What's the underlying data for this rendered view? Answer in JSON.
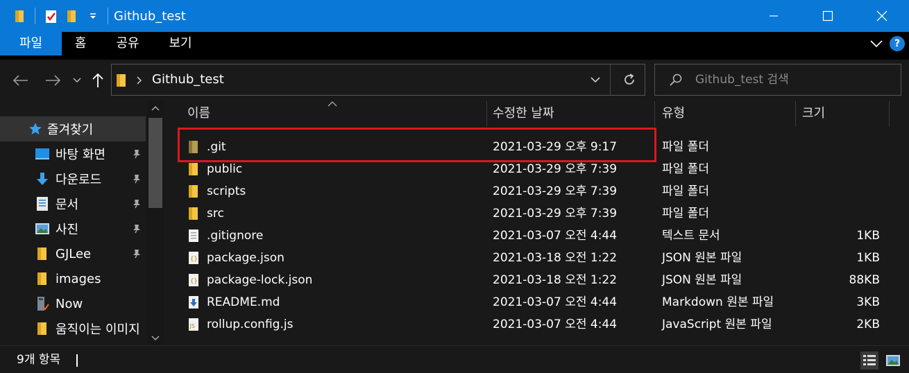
{
  "window": {
    "title": "Github_test",
    "accent": "#0a78d7",
    "highlight_color": "#e2151c"
  },
  "ribbon": {
    "tabs": [
      {
        "label": "파일",
        "active": true
      },
      {
        "label": "홈",
        "active": false
      },
      {
        "label": "공유",
        "active": false
      },
      {
        "label": "보기",
        "active": false
      }
    ],
    "help_label": "?"
  },
  "address": {
    "path": "Github_test",
    "search_placeholder": "Github_test 검색"
  },
  "sidebar": {
    "items": [
      {
        "label": "즐겨찾기",
        "icon": "star-icon",
        "pinned": false,
        "selected": true
      },
      {
        "label": "바탕 화면",
        "icon": "desktop-icon",
        "pinned": true
      },
      {
        "label": "다운로드",
        "icon": "download-icon",
        "pinned": true
      },
      {
        "label": "문서",
        "icon": "document-icon",
        "pinned": true
      },
      {
        "label": "사진",
        "icon": "pictures-icon",
        "pinned": true
      },
      {
        "label": "GJLee",
        "icon": "folder-icon",
        "pinned": true
      },
      {
        "label": "images",
        "icon": "folder-icon",
        "pinned": false
      },
      {
        "label": "Now",
        "icon": "drive-icon",
        "pinned": false
      },
      {
        "label": "움직이는 이미지",
        "icon": "folder-icon",
        "pinned": false
      }
    ]
  },
  "columns": {
    "name": "이름",
    "modified": "수정한 날짜",
    "type": "유형",
    "size": "크기"
  },
  "files": [
    {
      "name": ".git",
      "modified": "2021-03-29 오후 9:17",
      "type": "파일 폴더",
      "size": "",
      "icon": "folder-icon",
      "hidden": true
    },
    {
      "name": "public",
      "modified": "2021-03-29 오후 7:39",
      "type": "파일 폴더",
      "size": "",
      "icon": "folder-icon"
    },
    {
      "name": "scripts",
      "modified": "2021-03-29 오후 7:39",
      "type": "파일 폴더",
      "size": "",
      "icon": "folder-icon"
    },
    {
      "name": "src",
      "modified": "2021-03-29 오후 7:39",
      "type": "파일 폴더",
      "size": "",
      "icon": "folder-icon"
    },
    {
      "name": ".gitignore",
      "modified": "2021-03-07 오전 4:44",
      "type": "텍스트 문서",
      "size": "1KB",
      "icon": "text-file-icon"
    },
    {
      "name": "package.json",
      "modified": "2021-03-18 오전 1:22",
      "type": "JSON 원본 파일",
      "size": "1KB",
      "icon": "json-file-icon"
    },
    {
      "name": "package-lock.json",
      "modified": "2021-03-18 오전 1:22",
      "type": "JSON 원본 파일",
      "size": "88KB",
      "icon": "json-file-icon"
    },
    {
      "name": "README.md",
      "modified": "2021-03-07 오전 4:44",
      "type": "Markdown 원본 파일",
      "size": "3KB",
      "icon": "markdown-file-icon"
    },
    {
      "name": "rollup.config.js",
      "modified": "2021-03-07 오전 4:44",
      "type": "JavaScript 원본 파일",
      "size": "2KB",
      "icon": "js-file-icon"
    }
  ],
  "status": {
    "item_count": "9개 항목"
  }
}
